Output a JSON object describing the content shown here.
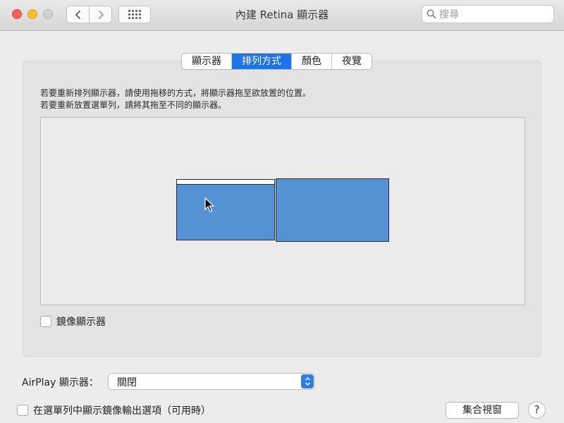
{
  "window": {
    "title": "內建 Retina 顯示器",
    "search_placeholder": "搜尋"
  },
  "toolbar": {
    "back_icon": "chevron-left-icon",
    "forward_icon": "chevron-right-icon",
    "show_all_icon": "grid-icon"
  },
  "tabs": [
    {
      "label": "顯示器",
      "active": false
    },
    {
      "label": "排列方式",
      "active": true
    },
    {
      "label": "顏色",
      "active": false
    },
    {
      "label": "夜覽",
      "active": false
    }
  ],
  "arrangement": {
    "instruction_line1": "若要重新排列顯示器，請使用拖移的方式，將顯示器拖至欲放置的位置。",
    "instruction_line2": "若要重新放置選單列，請將其拖至不同的顯示器。",
    "display_color": "#5592d3"
  },
  "mirror_displays": {
    "label": "鏡像顯示器",
    "checked": false
  },
  "airplay": {
    "label": "AirPlay 顯示器：",
    "selected": "關閉"
  },
  "show_mirroring_option": {
    "label": "在選單列中顯示鏡像輸出選項（可用時）",
    "checked": false
  },
  "gather_windows_button": "集合視窗",
  "help_button": "?"
}
